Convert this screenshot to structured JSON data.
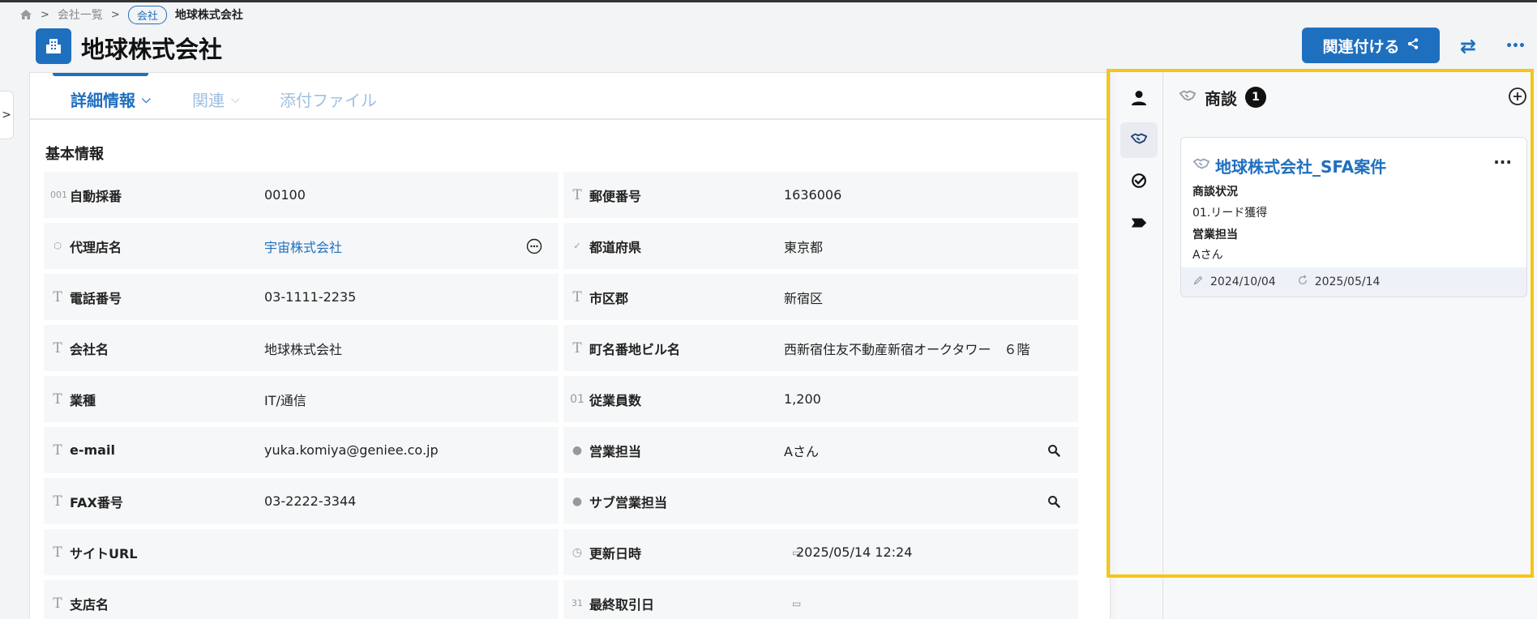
{
  "breadcrumb": {
    "home_label": "",
    "list_label": "会社一覧",
    "badge_label": "会社",
    "current_label": "地球株式会社"
  },
  "header": {
    "title": "地球株式会社",
    "link_button_label": "関連付ける",
    "swap_icon": "⇄",
    "more_icon": "•••"
  },
  "tabs": [
    {
      "label": "詳細情報",
      "active": true
    },
    {
      "label": "関連",
      "active": false
    },
    {
      "label": "添付ファイル",
      "active": false
    }
  ],
  "section": {
    "title": "基本情報"
  },
  "fields": [
    [
      {
        "icon": "001",
        "label": "自動採番",
        "value": "00100"
      },
      {
        "icon": "T",
        "label": "郵便番号",
        "value": "1636006"
      }
    ],
    [
      {
        "icon": "⬡",
        "label": "代理店名",
        "value": "宇宙株式会社"
      },
      {
        "icon": "✓",
        "label": "都道府県",
        "value": "東京都"
      }
    ],
    [
      {
        "icon": "T",
        "label": "電話番号",
        "value": "03-1111-2235"
      },
      {
        "icon": "T",
        "label": "市区郡",
        "value": "新宿区"
      }
    ],
    [
      {
        "icon": "T",
        "label": "会社名",
        "value": "地球株式会社"
      },
      {
        "icon": "T",
        "label": "町名番地ビル名",
        "value": "西新宿住友不動産新宿オークタワー　６階"
      }
    ],
    [
      {
        "icon": "T",
        "label": "業種",
        "value": "IT/通信"
      },
      {
        "icon": "01",
        "label": "従業員数",
        "value": "1,200"
      }
    ],
    [
      {
        "icon": "T",
        "label": "e-mail",
        "value": "yuka.komiya@geniee.co.jp"
      },
      {
        "icon": "●",
        "label": "営業担当",
        "value": "Aさん"
      }
    ],
    [
      {
        "icon": "T",
        "label": "FAX番号",
        "value": "03-2222-3344"
      },
      {
        "icon": "●",
        "label": "サブ営業担当",
        "value": ""
      }
    ],
    [
      {
        "icon": "T",
        "label": "サイトURL",
        "value": ""
      },
      {
        "icon": "◷",
        "label": "更新日時",
        "value": "2025/05/14 12:24"
      }
    ],
    [
      {
        "icon": "T",
        "label": "支店名",
        "value": ""
      },
      {
        "icon": "31",
        "label": "最終取引日",
        "value": ""
      }
    ]
  ],
  "right_panel": {
    "title": "商談",
    "count": "1",
    "deal": {
      "title": "地球株式会社_SFA案件",
      "status_label": "商談状況",
      "status_value": "01.リード獲得",
      "owner_label": "営業担当",
      "owner_value": "Aさん",
      "created_date": "2024/10/04",
      "updated_date": "2025/05/14"
    }
  },
  "colors": {
    "accent": "#1f6fbf",
    "highlight": "#f5c518"
  }
}
